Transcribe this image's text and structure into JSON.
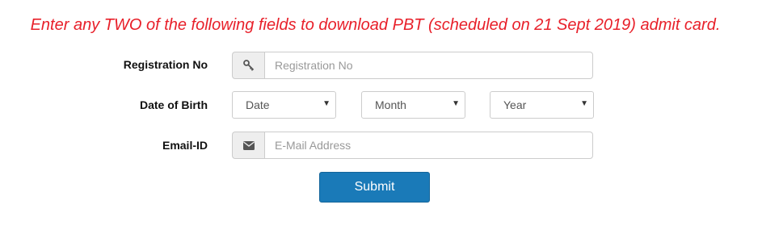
{
  "notice": "Enter any TWO of the following fields to download PBT (scheduled on 21 Sept 2019) admit card.",
  "fields": {
    "registration": {
      "label": "Registration No",
      "placeholder": "Registration No",
      "value": "",
      "icon": "key-icon"
    },
    "dob": {
      "label": "Date of Birth",
      "date": "Date",
      "month": "Month",
      "year": "Year"
    },
    "email": {
      "label": "Email-ID",
      "placeholder": "E-Mail Address",
      "value": "",
      "icon": "envelope-icon"
    }
  },
  "submit": "Submit",
  "colors": {
    "notice": "#e8202a",
    "button": "#1a7ab8"
  }
}
